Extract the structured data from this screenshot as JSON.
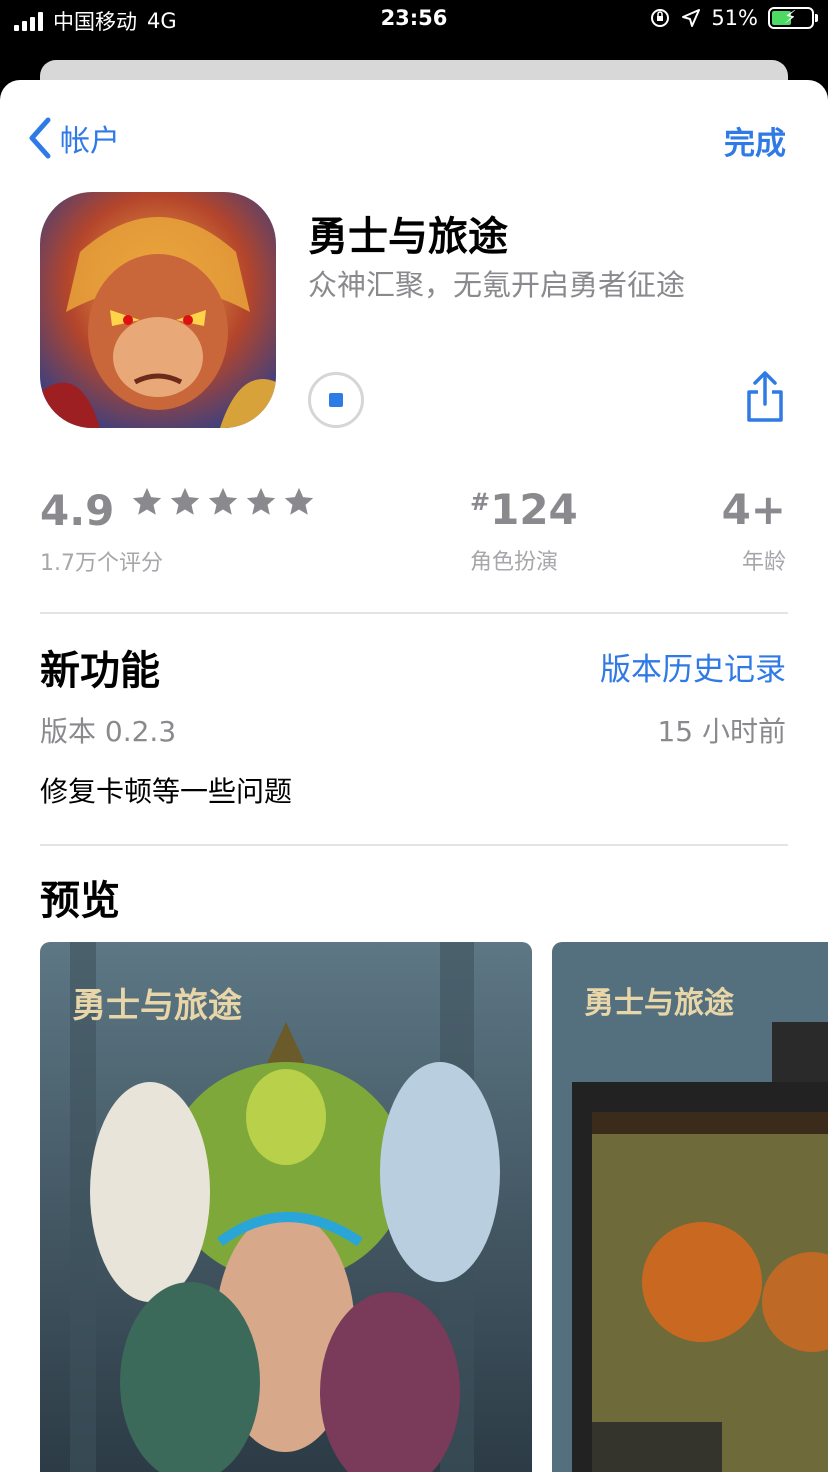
{
  "status_bar": {
    "carrier": "中国移动",
    "network": "4G",
    "time": "23:56",
    "battery_percent": "51%",
    "battery_level": 0.51
  },
  "nav": {
    "back_label": "帐户",
    "done_label": "完成"
  },
  "app": {
    "title": "勇士与旅途",
    "subtitle": "众神汇聚，无氪开启勇者征途"
  },
  "ratings": {
    "score": "4.9",
    "stars": 5,
    "count_label": "1.7万个评分",
    "rank_hash": "#",
    "rank_number": "124",
    "rank_category": "角色扮演",
    "age": "4+",
    "age_label": "年龄"
  },
  "whats_new": {
    "title": "新功能",
    "history_link": "版本历史记录",
    "version": "版本 0.2.3",
    "time_ago": "15 小时前",
    "notes": "修复卡顿等一些问题"
  },
  "preview": {
    "title": "预览",
    "shot1_logo": "勇士与旅途",
    "shot2_logo": "勇士与旅途"
  },
  "colors": {
    "accent": "#2f7ae5",
    "secondary_text": "#8a8a8e"
  }
}
